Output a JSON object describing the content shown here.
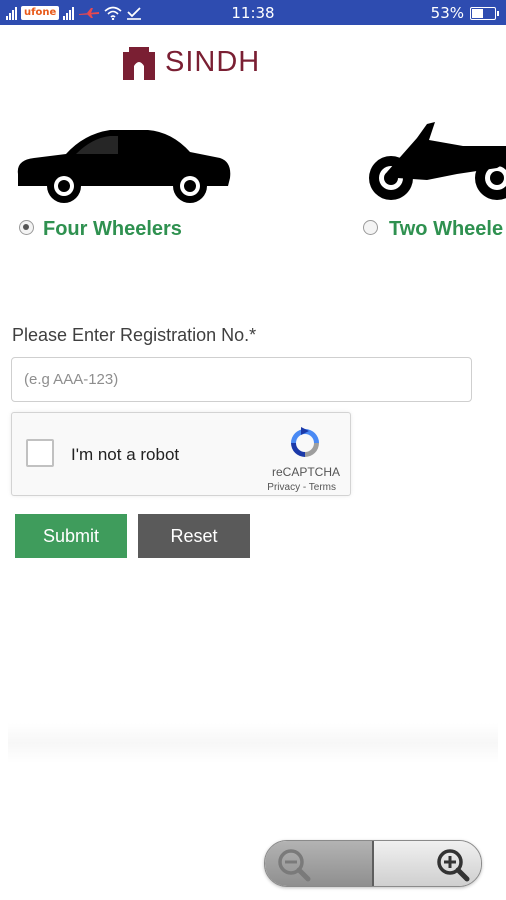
{
  "status_bar": {
    "carrier": "ufone",
    "time": "11:38",
    "battery": "53%",
    "battery_level": 0.53
  },
  "header": {
    "logo_text": "SINDH",
    "logo_color": "#7a1f33"
  },
  "vehicle_options": [
    {
      "label": "Four Wheelers",
      "icon": "car-icon",
      "selected": true
    },
    {
      "label": "Two Wheele",
      "icon": "motorcycle-icon",
      "selected": false
    }
  ],
  "form": {
    "registration_label": "Please Enter Registration No.*",
    "registration_placeholder": "(e.g AAA-123)",
    "registration_value": ""
  },
  "captcha": {
    "label": "I'm not a robot",
    "brand": "reCAPTCHA",
    "links": "Privacy - Terms"
  },
  "buttons": {
    "submit": "Submit",
    "reset": "Reset"
  },
  "zoom": {
    "out_icon": "zoom-out-icon",
    "in_icon": "zoom-in-icon"
  },
  "colors": {
    "status_bar": "#2e4cb0",
    "accent_green": "#3f9c5c",
    "reset_gray": "#5a5a5a"
  }
}
